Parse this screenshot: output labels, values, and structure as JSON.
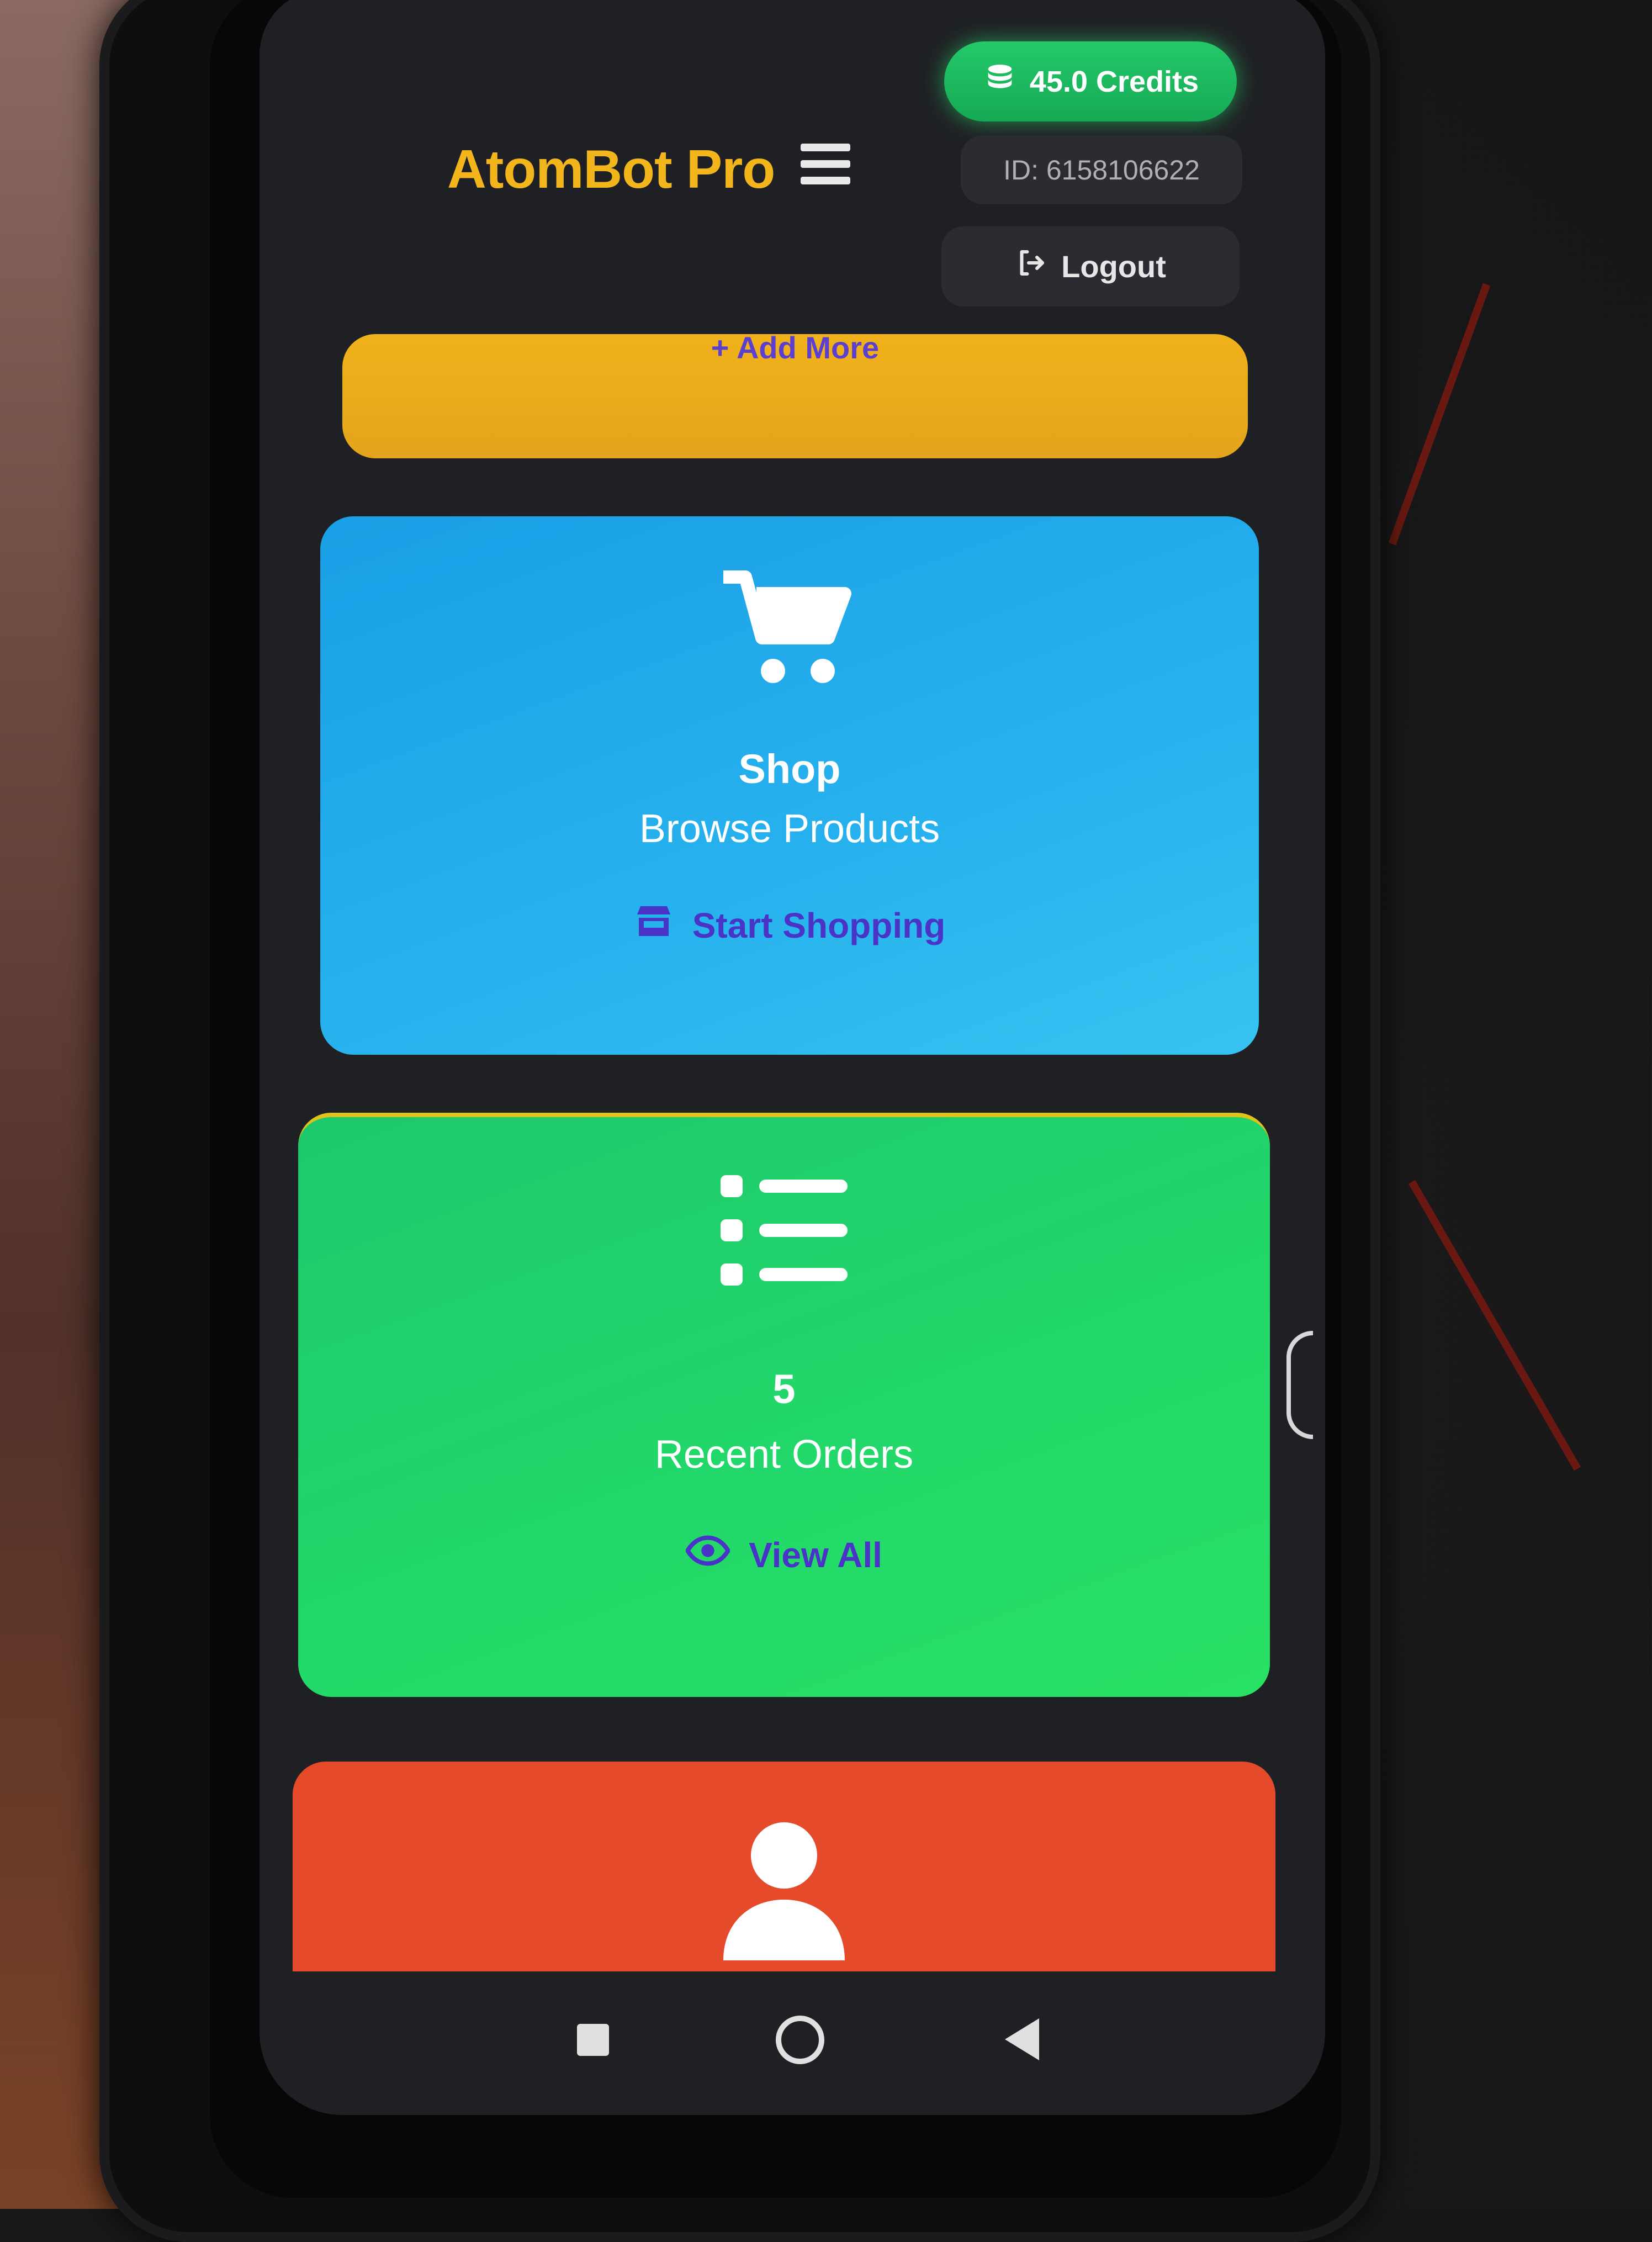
{
  "header": {
    "credits_label": "45.0 Credits",
    "app_title": "AtomBot Pro",
    "user_id": "ID: 6158106622",
    "logout_label": "Logout"
  },
  "cards": {
    "add_more": {
      "label": "+ Add More",
      "color": "#e4a41d"
    },
    "shop": {
      "title": "Shop",
      "subtitle": "Browse Products",
      "action": "Start Shopping",
      "color": "#27b2ee"
    },
    "orders": {
      "count": "5",
      "subtitle": "Recent Orders",
      "action": "View All",
      "color": "#22d86a"
    },
    "profile": {
      "color": "#e54b2a"
    }
  },
  "icons": {
    "credits": "coins-icon",
    "menu": "hamburger-menu-icon",
    "logout": "logout-icon",
    "shop": "shopping-cart-icon",
    "store": "store-icon",
    "orders": "list-icon",
    "view": "eye-icon",
    "profile": "user-icon"
  },
  "navbar": {
    "buttons": [
      "recents-button",
      "home-button",
      "back-button"
    ]
  },
  "colors": {
    "accent_title": "#f2b51c",
    "link": "#4a34c8",
    "screen_bg": "#1f2024"
  }
}
